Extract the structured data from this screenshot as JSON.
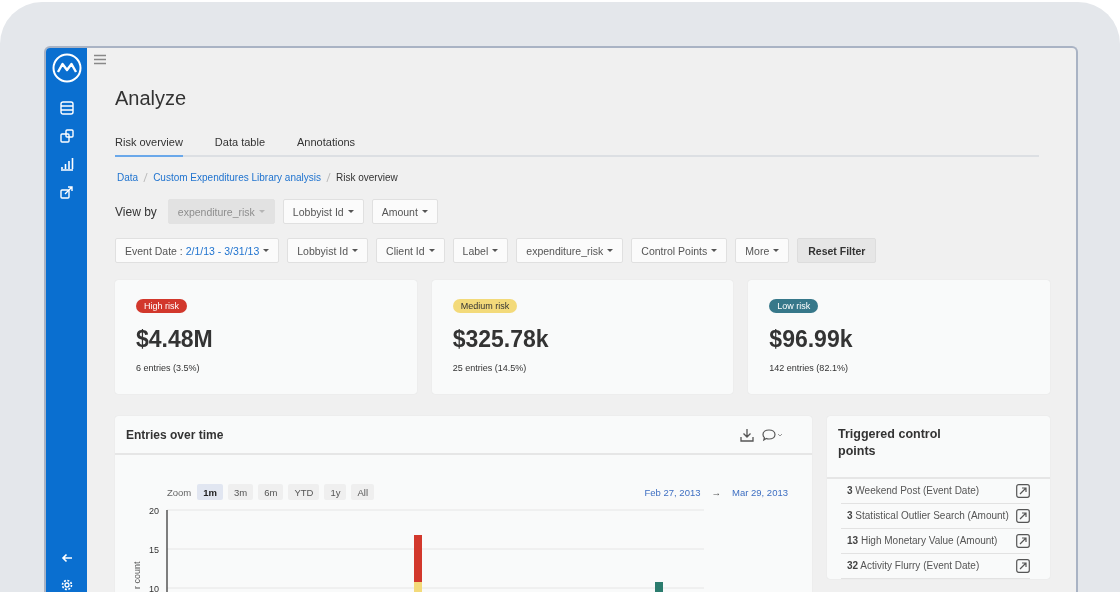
{
  "page": {
    "title": "Analyze"
  },
  "tabs": [
    {
      "label": "Risk overview",
      "selected": true
    },
    {
      "label": "Data table",
      "selected": false
    },
    {
      "label": "Annotations",
      "selected": false
    }
  ],
  "breadcrumb": [
    {
      "label": "Data",
      "kind": "link"
    },
    {
      "label": "Custom Expenditures Library analysis",
      "kind": "link"
    },
    {
      "label": "Risk overview",
      "kind": "current"
    }
  ],
  "view_by": {
    "label": "View by",
    "dropdowns": [
      {
        "label": "expenditure_risk",
        "disabled": true
      },
      {
        "label": "Lobbyist Id",
        "disabled": false
      },
      {
        "label": "Amount",
        "disabled": false
      }
    ]
  },
  "filters": [
    {
      "label": "Event Date :",
      "value": "2/1/13 - 3/31/13"
    },
    {
      "label": "Lobbyist Id"
    },
    {
      "label": "Client Id"
    },
    {
      "label": "Label"
    },
    {
      "label": "expenditure_risk"
    },
    {
      "label": "Control Points"
    },
    {
      "label": "More"
    }
  ],
  "reset_button": "Reset Filter",
  "risk_cards": [
    {
      "badge": "High risk",
      "color": "#d2382c",
      "amount": "$4.48M",
      "entries": "6 entries (3.5%)"
    },
    {
      "badge": "Medium risk",
      "color": "#f3da7a",
      "amount": "$325.78k",
      "entries": "25 entries (14.5%)"
    },
    {
      "badge": "Low risk",
      "color": "#37788a",
      "amount": "$96.99k",
      "entries": "142 entries (82.1%)"
    }
  ],
  "entries_chart": {
    "title": "Entries over time",
    "zoom_label": "Zoom",
    "zoom_options": [
      {
        "label": "1m",
        "selected": true
      },
      {
        "label": "3m",
        "selected": false
      },
      {
        "label": "6m",
        "selected": false
      },
      {
        "label": "YTD",
        "selected": false
      },
      {
        "label": "1y",
        "selected": false
      },
      {
        "label": "All",
        "selected": false
      }
    ],
    "range_start": "Feb 27, 2013",
    "range_arrow": "→",
    "range_end": "Mar 29, 2013",
    "y_ticks": [
      "20",
      "15",
      "10"
    ],
    "y_label": "r count"
  },
  "control_points": {
    "title": "Triggered control points",
    "items": [
      {
        "count": "3",
        "label": "Weekend Post (Event Date)"
      },
      {
        "count": "3",
        "label": "Statistical Outlier Search (Amount)"
      },
      {
        "count": "13",
        "label": "High Monetary Value (Amount)"
      },
      {
        "count": "32",
        "label": "Activity Flurry (Event Date)"
      }
    ]
  }
}
